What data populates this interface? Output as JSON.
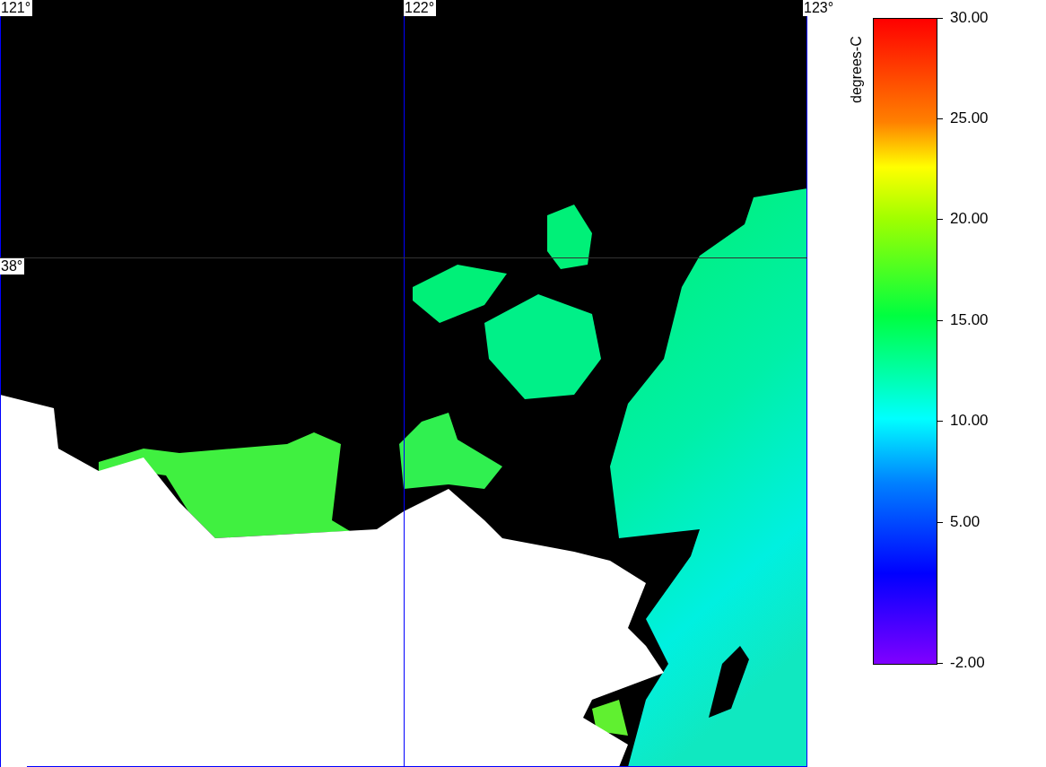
{
  "map": {
    "lon_labels": [
      "121°",
      "122°",
      "123°"
    ],
    "lat_labels": [
      "38°"
    ]
  },
  "colorbar": {
    "title": "degrees-C",
    "ticks": [
      "30.00",
      "25.00",
      "20.00",
      "15.00",
      "10.00",
      "5.00",
      "-2.00"
    ]
  }
}
